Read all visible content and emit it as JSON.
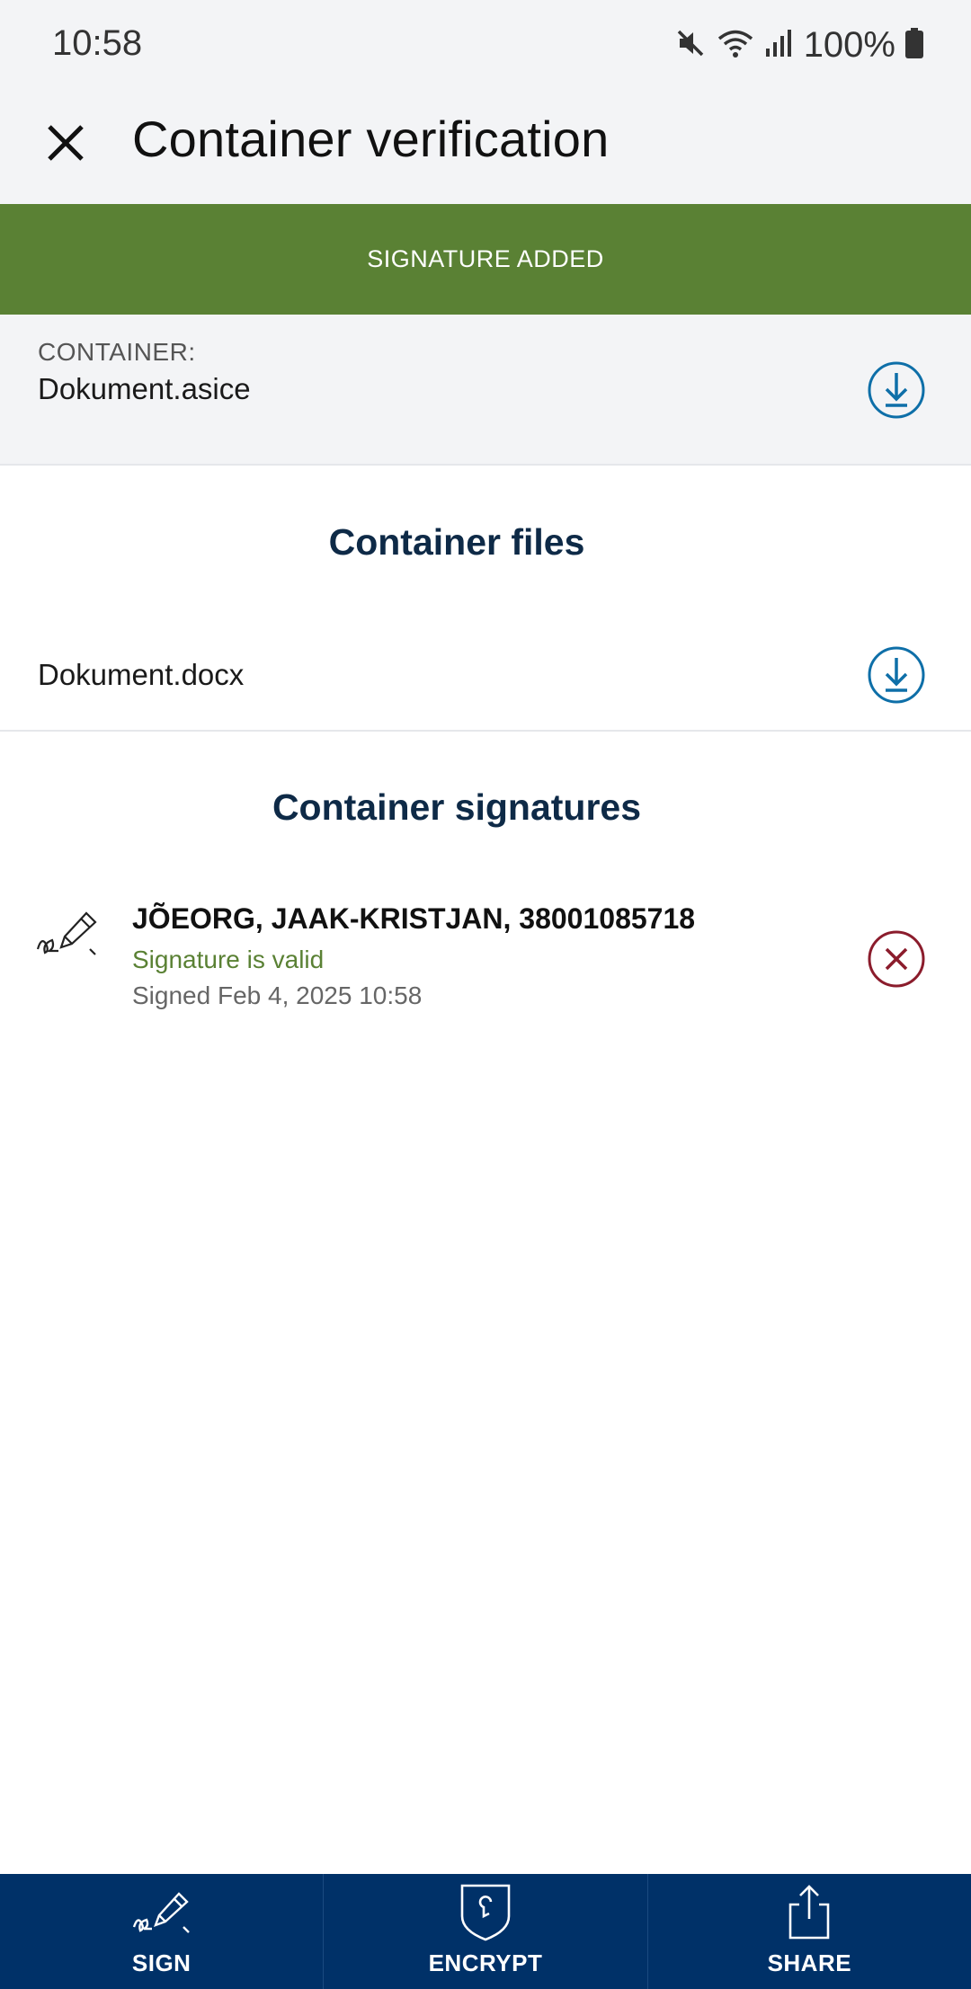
{
  "status_bar": {
    "time": "10:58",
    "battery": "100%",
    "icons": [
      "mute-icon",
      "wifi-icon",
      "signal-icon",
      "battery-icon"
    ]
  },
  "app_bar": {
    "title": "Container verification",
    "close_icon": "close-icon"
  },
  "banner": {
    "text": "SIGNATURE ADDED",
    "color": "#5a8134"
  },
  "container": {
    "label": "CONTAINER:",
    "name": "Dokument.asice"
  },
  "files_section": {
    "title": "Container files",
    "files": [
      {
        "name": "Dokument.docx"
      }
    ]
  },
  "signatures_section": {
    "title": "Container signatures",
    "signatures": [
      {
        "name": "JÕEORG, JAAK-KRISTJAN, 38001085718",
        "status": "Signature is valid",
        "date": "Signed Feb 4, 2025 10:58"
      }
    ]
  },
  "bottom_nav": {
    "items": [
      {
        "label": "SIGN",
        "icon": "sign-icon"
      },
      {
        "label": "ENCRYPT",
        "icon": "encrypt-icon"
      },
      {
        "label": "SHARE",
        "icon": "share-icon"
      }
    ]
  },
  "colors": {
    "accent": "#0e6fa8",
    "nav_background": "#003168",
    "valid": "#5a8134",
    "remove": "#8b1c2c"
  }
}
